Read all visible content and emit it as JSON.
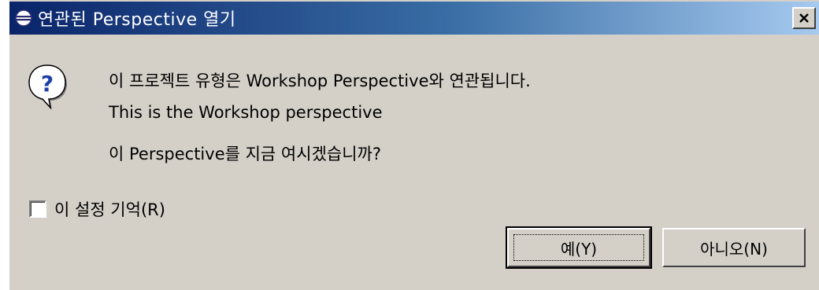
{
  "window": {
    "title": "연관된 Perspective 열기",
    "close_symbol": "✕"
  },
  "icons": {
    "title": "eclipse-icon",
    "message": "question-icon",
    "question_mark": "?"
  },
  "message": {
    "line1": "이 프로젝트 유형은 Workshop Perspective와 연관됩니다.",
    "line2": "This is the Workshop perspective",
    "line3": "이 Perspective를 지금 여시겠습니까?"
  },
  "remember": {
    "label": "이 설정 기억(R)",
    "checked": false
  },
  "buttons": {
    "yes_label": "예(Y)",
    "no_label": "아니오(N)"
  },
  "colors": {
    "title_start": "#0a246a",
    "title_end": "#a6caf0",
    "dialog_bg": "#d4d0c8"
  }
}
